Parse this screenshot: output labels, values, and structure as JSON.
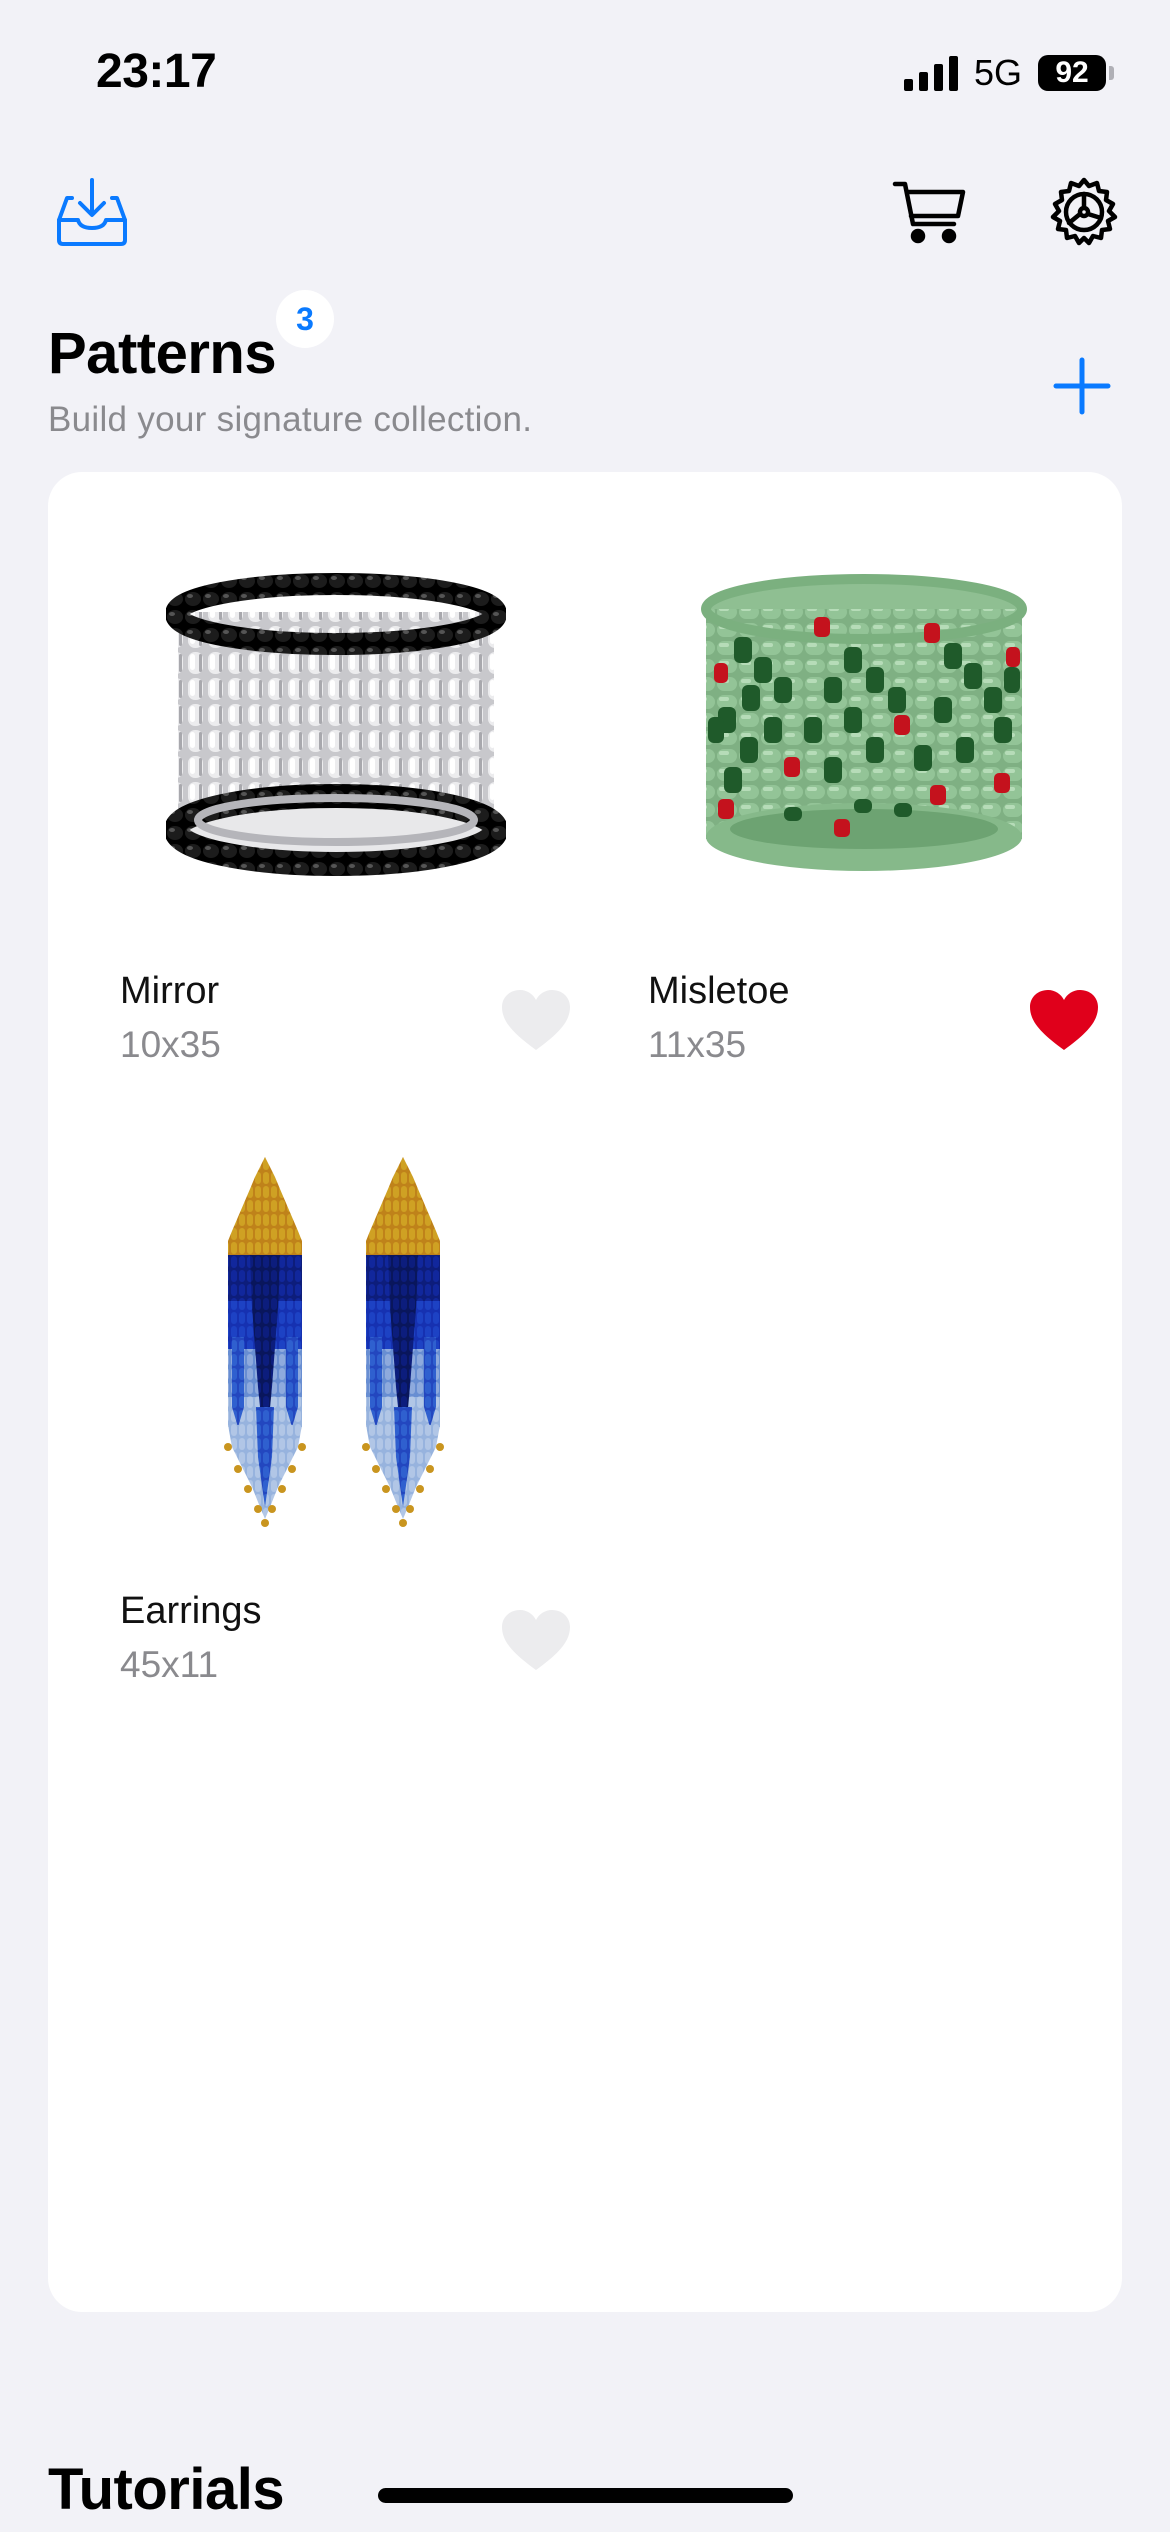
{
  "status_bar": {
    "time": "23:17",
    "network": "5G",
    "battery": "92"
  },
  "toolbar": {
    "inbox_icon": "tray-download-icon",
    "cart_icon": "cart-icon",
    "settings_icon": "steering-wheel-gear-icon"
  },
  "section": {
    "title": "Patterns",
    "count": "3",
    "subtitle": "Build your signature collection.",
    "add_icon": "plus-icon"
  },
  "patterns": [
    {
      "name": "Mirror",
      "size": "10x35",
      "favorite": false,
      "thumb": "mirror-bracelet",
      "colors": [
        "#1a1a1a",
        "#d9d9dc"
      ]
    },
    {
      "name": "Misletoe",
      "size": "11x35",
      "favorite": true,
      "thumb": "misletoe-bracelet",
      "colors": [
        "#8fbf92",
        "#1f5a2a",
        "#c4121d"
      ]
    },
    {
      "name": "Earrings",
      "size": "45x11",
      "favorite": false,
      "thumb": "earrings",
      "colors": [
        "#c9951f",
        "#0f238f",
        "#2a56c9",
        "#a7bfe3"
      ]
    }
  ],
  "tutorials": {
    "title": "Tutorials"
  },
  "colors": {
    "accent": "#0a7aff",
    "favorite_active": "#e0001b",
    "favorite_inactive": "#ececee"
  }
}
